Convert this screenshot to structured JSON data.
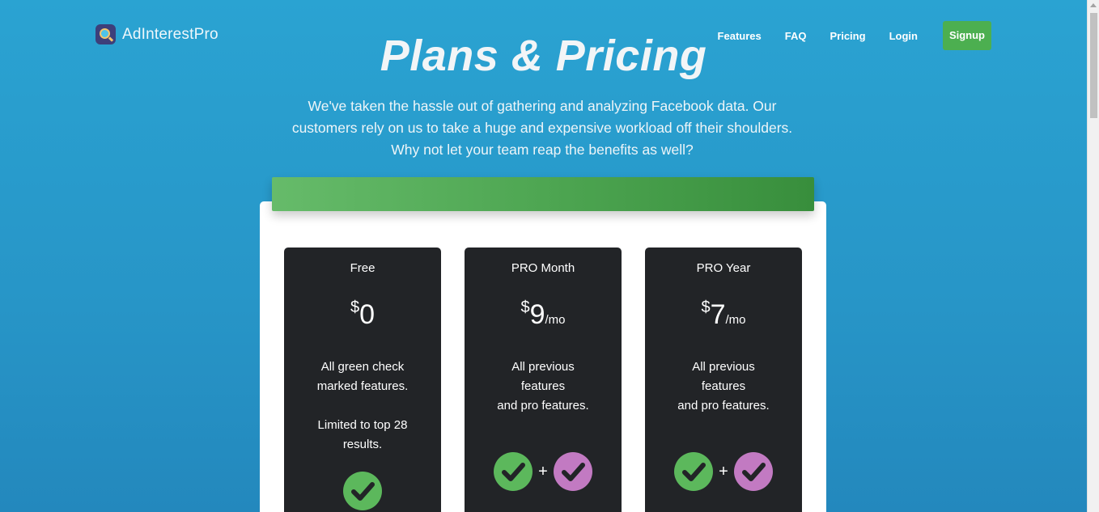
{
  "brand": {
    "name": "AdInterestPro"
  },
  "nav": {
    "items": [
      "Features",
      "FAQ",
      "Pricing",
      "Login"
    ],
    "signup": "Signup"
  },
  "hero": {
    "title": "Plans & Pricing",
    "subtitle_lines": [
      "We've taken the hassle out of gathering and analyzing Facebook data. Our",
      "customers rely on us to take a huge and expensive workload off their shoulders.",
      "Why not let your team reap the benefits as well?"
    ]
  },
  "plans": [
    {
      "name": "Free",
      "currency": "$",
      "amount": "0",
      "period": "",
      "desc_lines": [
        "All green check",
        "marked features.",
        "",
        "Limited to top 28",
        "results."
      ],
      "checks": [
        "green"
      ]
    },
    {
      "name": "PRO Month",
      "currency": "$",
      "amount": "9",
      "period": "/mo",
      "desc_lines": [
        "All previous",
        "features",
        "and pro features."
      ],
      "checks": [
        "green",
        "purple"
      ]
    },
    {
      "name": "PRO Year",
      "currency": "$",
      "amount": "7",
      "period": "/mo",
      "desc_lines": [
        "All previous",
        "features",
        "and pro features."
      ],
      "checks": [
        "green",
        "purple"
      ]
    }
  ],
  "plus_symbol": "+",
  "colors": {
    "background": "#2aa3d2",
    "signup": "#4caf50",
    "plan_card": "#222427",
    "check_green": "#5cb85c",
    "check_purple": "#c27ac2"
  }
}
